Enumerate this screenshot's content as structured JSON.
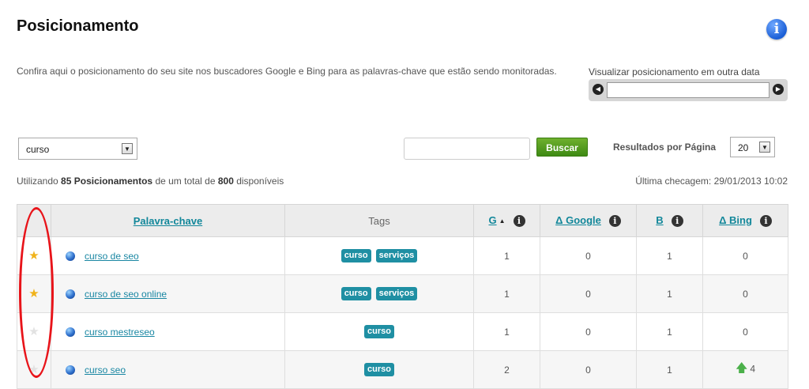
{
  "header": {
    "title": "Posicionamento",
    "info_icon": "info-icon",
    "description": "Confira aqui o posicionamento do seu site nos buscadores Google e Bing para as palavras-chave que estão sendo monitoradas."
  },
  "date_picker": {
    "label": "Visualizar posicionamento em outra data",
    "value": "",
    "prev_icon": "arrow-left-icon",
    "next_icon": "arrow-right-icon"
  },
  "filters": {
    "keyword_select": "curso",
    "search_value": "",
    "search_button": "Buscar",
    "per_page_label": "Resultados por Página",
    "per_page_value": "20"
  },
  "summary": {
    "prefix": "Utilizando",
    "used": "85 Posicionamentos",
    "middle": "de um total de",
    "total": "800",
    "suffix": "disponíveis",
    "last_check": "Última checagem: 29/01/2013 10:02"
  },
  "table": {
    "headers": {
      "keyword": "Palavra-chave",
      "tags": "Tags",
      "google": "G",
      "delta_google": "Δ Google",
      "bing": "B",
      "delta_bing": "Δ Bing"
    },
    "rows": [
      {
        "starred": true,
        "keyword": "curso de seo",
        "tags": [
          "curso",
          "serviços"
        ],
        "google": "1",
        "delta_google": "0",
        "bing": "1",
        "delta_bing": "0"
      },
      {
        "starred": true,
        "keyword": "curso de seo online",
        "tags": [
          "curso",
          "serviços"
        ],
        "google": "1",
        "delta_google": "0",
        "bing": "1",
        "delta_bing": "0"
      },
      {
        "starred": false,
        "keyword": "curso mestreseo",
        "tags": [
          "curso"
        ],
        "google": "1",
        "delta_google": "0",
        "bing": "1",
        "delta_bing": "0"
      },
      {
        "starred": false,
        "keyword": "curso seo",
        "tags": [
          "curso"
        ],
        "google": "2",
        "delta_google": "0",
        "bing": "1",
        "delta_bing": "4",
        "bing_trend": "up"
      }
    ]
  },
  "colors": {
    "accent": "#1f8fa3",
    "button": "#4e9a1f",
    "star_active": "#f0b21a",
    "annotation": "#e8141a"
  }
}
